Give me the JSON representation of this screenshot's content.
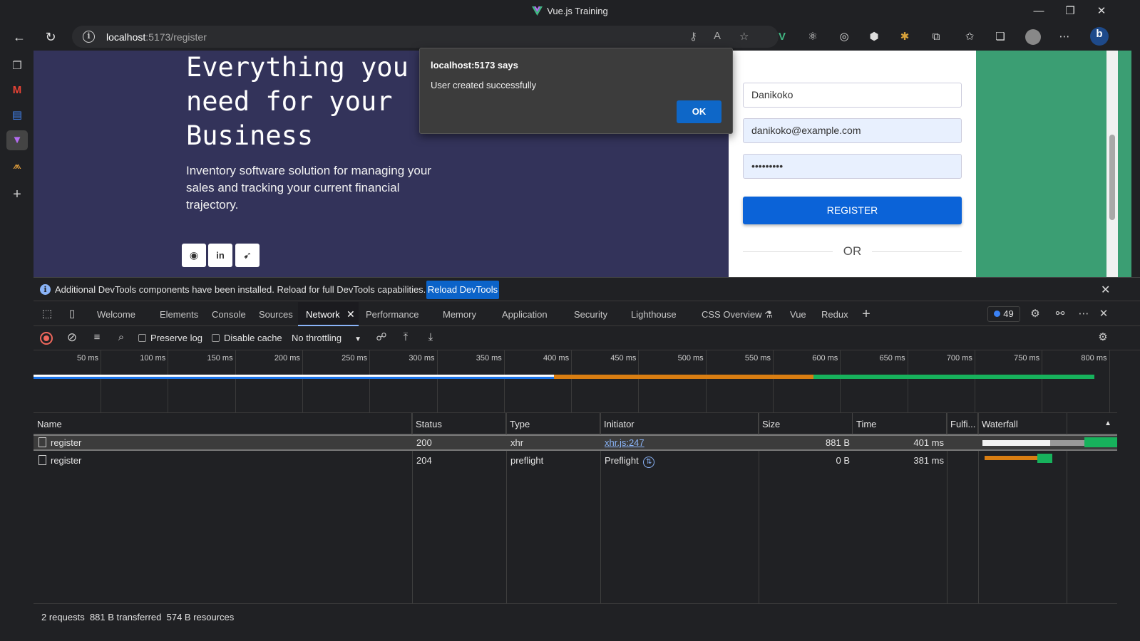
{
  "window": {
    "title": "Vue.js Training"
  },
  "nav": {
    "url_host": "localhost",
    "url_path": ":5173/register"
  },
  "hero": {
    "title": "Everything you need for your Business",
    "subtitle": "Inventory software solution for managing your sales and tracking your current financial trajectory.",
    "social": [
      "github-icon",
      "linkedin-icon",
      "twitter-icon"
    ]
  },
  "form": {
    "name_value": "Danikoko",
    "email_value": "danikoko@example.com",
    "password_value": "•••••••••",
    "register_label": "REGISTER",
    "or_label": "OR"
  },
  "alert": {
    "title": "localhost:5173 says",
    "message": "User created successfully",
    "ok_label": "OK"
  },
  "devtools": {
    "info_message": "Additional DevTools components have been installed. Reload for full DevTools capabilities.",
    "reload_label": "Reload DevTools",
    "tabs": [
      "Welcome",
      "Elements",
      "Console",
      "Sources",
      "Network",
      "Performance",
      "Memory",
      "Application",
      "Security",
      "Lighthouse",
      "CSS Overview",
      "Vue",
      "Redux"
    ],
    "active_tab": "Network",
    "issues_count": "49",
    "toolbar": {
      "preserve_log": "Preserve log",
      "disable_cache": "Disable cache",
      "throttling": "No throttling"
    },
    "timeline_ticks": [
      "50 ms",
      "100 ms",
      "150 ms",
      "200 ms",
      "250 ms",
      "300 ms",
      "350 ms",
      "400 ms",
      "450 ms",
      "500 ms",
      "550 ms",
      "600 ms",
      "650 ms",
      "700 ms",
      "750 ms",
      "800 ms"
    ],
    "columns": [
      "Name",
      "Status",
      "Type",
      "Initiator",
      "Size",
      "Time",
      "Fulfi...",
      "Waterfall"
    ],
    "rows": [
      {
        "name": "register",
        "status": "200",
        "type": "xhr",
        "initiator": "xhr.js:247",
        "size": "881 B",
        "time": "401 ms"
      },
      {
        "name": "register",
        "status": "204",
        "type": "preflight",
        "initiator": "Preflight",
        "size": "0 B",
        "time": "381 ms"
      }
    ],
    "summary": {
      "requests": "2 requests",
      "transferred": "881 B transferred",
      "resources": "574 B resources"
    }
  },
  "colors": {
    "hero_bg": "#33335a",
    "accent_blue": "#0b63d8",
    "green_panel": "#3b9e73",
    "waterfall_orange": "#d97e12",
    "waterfall_green": "#17b25c"
  }
}
